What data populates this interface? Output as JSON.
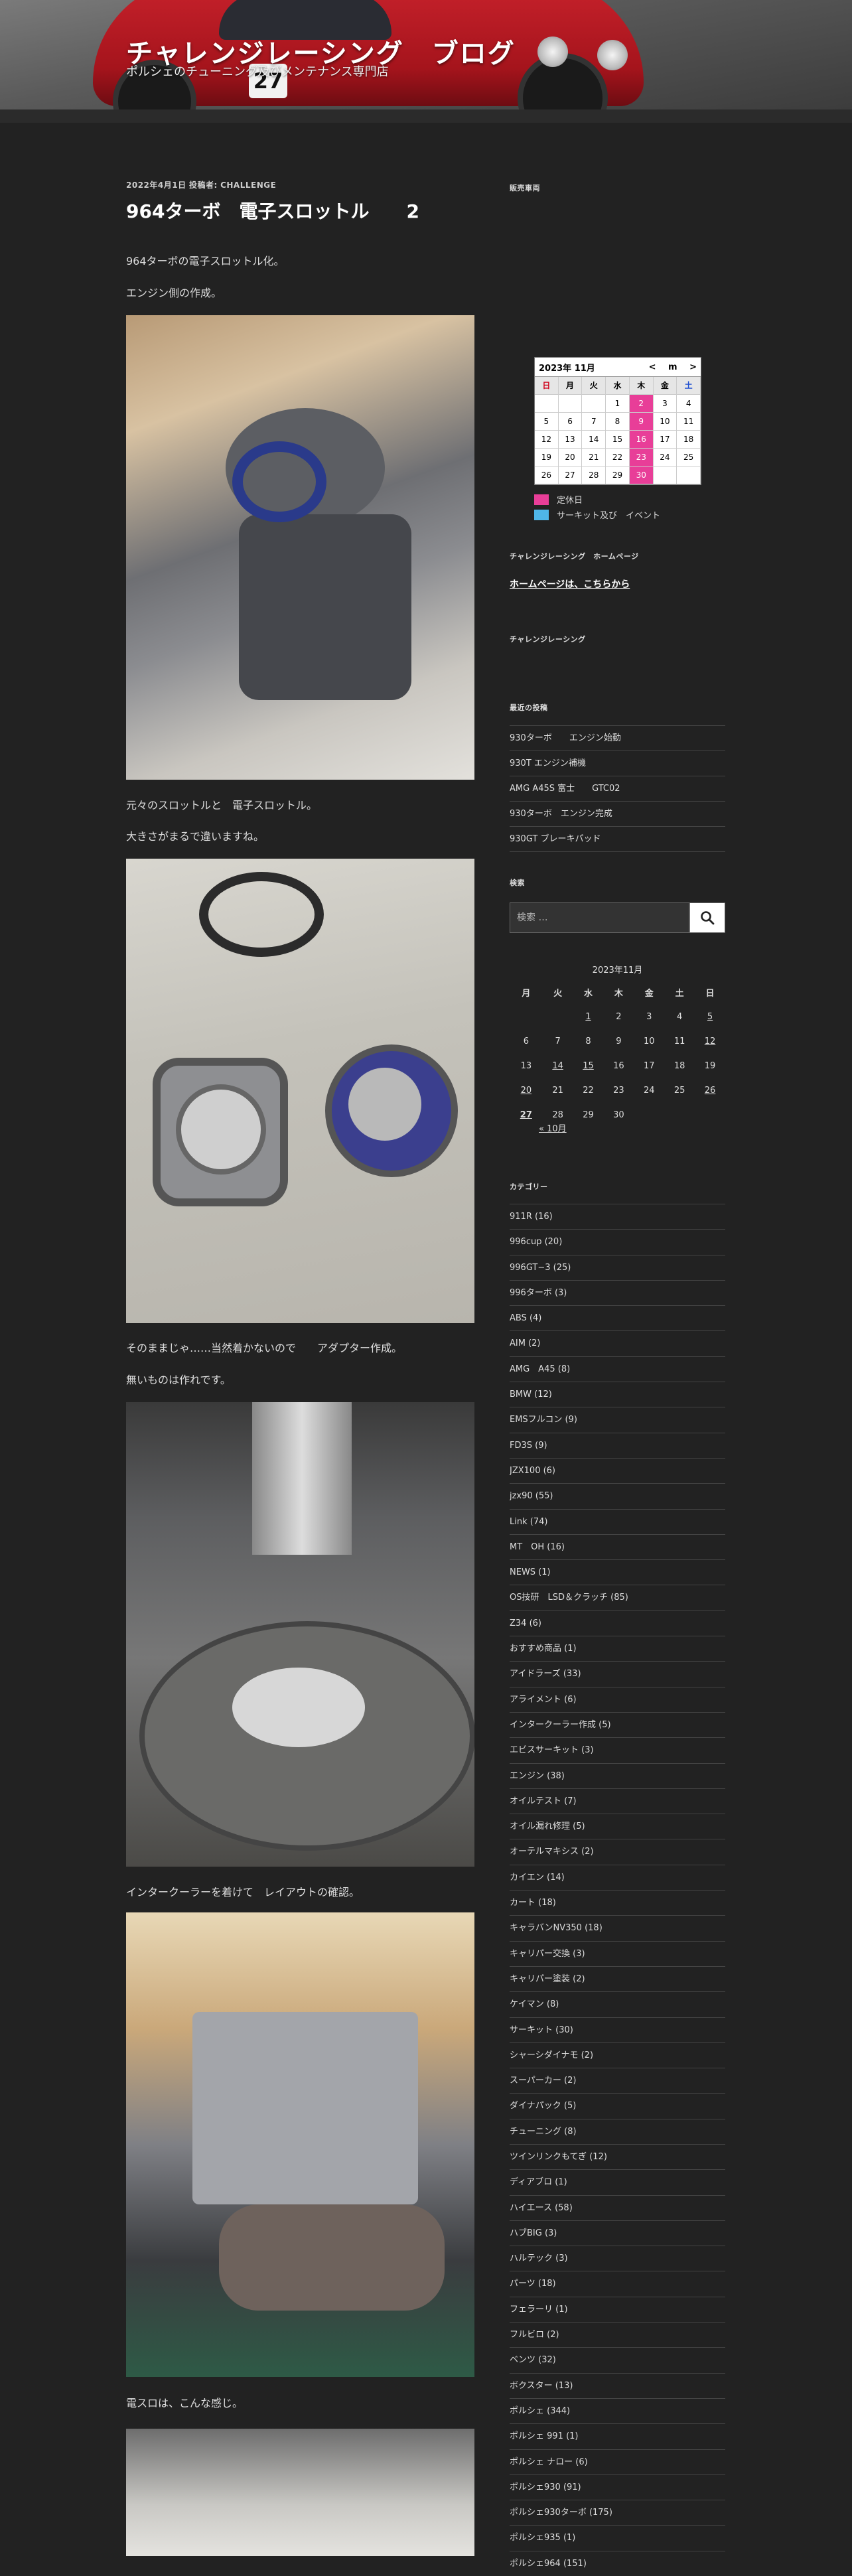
{
  "header": {
    "title": "チャレンジレーシング　ブログ",
    "description": "ポルシェのチューニング及びメンテナンス専門店",
    "car_number": "27"
  },
  "post": {
    "date": "2022年4月1日",
    "author_label": "投稿者:",
    "author": "CHALLENGE",
    "title": "964ターボ　電子スロットル　　2",
    "paragraphs": [
      "964ターボの電子スロットル化。",
      "エンジン側の作成。",
      "元々のスロットルと　電子スロットル。",
      "大きさがまるで違いますね。",
      "そのままじゃ……当然着かないので　　アダプター作成。",
      "無いものは作れです。",
      "インタークーラーを着けて　レイアウトの確認。",
      "電スロは、こんな感じ。"
    ]
  },
  "sidebar": {
    "sales_title": "販売車両",
    "mini_calendar": {
      "month": "2023年 11月",
      "prev": "<",
      "next": ">",
      "mid": "m",
      "dows": [
        "日",
        "月",
        "火",
        "水",
        "木",
        "金",
        "土"
      ],
      "rows": [
        [
          "",
          "",
          "",
          "1",
          "2",
          "3",
          "4"
        ],
        [
          "5",
          "6",
          "7",
          "8",
          "9",
          "10",
          "11"
        ],
        [
          "12",
          "13",
          "14",
          "15",
          "16",
          "17",
          "18"
        ],
        [
          "19",
          "20",
          "21",
          "22",
          "23",
          "24",
          "25"
        ],
        [
          "26",
          "27",
          "28",
          "29",
          "30",
          "",
          ""
        ]
      ],
      "holidays": [
        "2",
        "9",
        "16",
        "23",
        "30"
      ]
    },
    "legend": [
      {
        "label": "定休日",
        "color": "#e83e98"
      },
      {
        "label": "サーキット及び　イベント",
        "color": "#4fb6e8"
      }
    ],
    "homepage_title": "チャレンジレーシング　ホームページ",
    "homepage_link": "ホームページは、こちらから",
    "cr_title": "チャレンジレーシング",
    "recent_title": "最近の投稿",
    "recent_posts": [
      "930ターボ　　エンジン始動",
      "930T エンジン補機",
      "AMG A45S 富士　　GTC02",
      "930ターボ　エンジン完成",
      "930GT ブレーキパッド"
    ],
    "search_title": "検索",
    "search_placeholder": "検索 …",
    "calendar": {
      "caption": "2023年11月",
      "dows": [
        "月",
        "火",
        "水",
        "木",
        "金",
        "土",
        "日"
      ],
      "rows": [
        [
          "",
          "",
          "1",
          "2",
          "3",
          "4",
          "5"
        ],
        [
          "6",
          "7",
          "8",
          "9",
          "10",
          "11",
          "12"
        ],
        [
          "13",
          "14",
          "15",
          "16",
          "17",
          "18",
          "19"
        ],
        [
          "20",
          "21",
          "22",
          "23",
          "24",
          "25",
          "26"
        ],
        [
          "27",
          "28",
          "29",
          "30",
          "",
          "",
          ""
        ]
      ],
      "linked": [
        "1",
        "5",
        "12",
        "14",
        "15",
        "20",
        "26",
        "27"
      ],
      "prev": "« 10月"
    },
    "categories_title": "カテゴリー",
    "categories": [
      "911R (16)",
      "996cup (20)",
      "996GT−3 (25)",
      "996ターボ (3)",
      "ABS (4)",
      "AIM (2)",
      "AMG　A45 (8)",
      "BMW (12)",
      "EMSフルコン (9)",
      "FD3S (9)",
      "JZX100 (6)",
      "jzx90 (55)",
      "Link (74)",
      "MT　OH (16)",
      "NEWS (1)",
      "OS技研　LSD＆クラッチ (85)",
      "Z34 (6)",
      "おすすめ商品 (1)",
      "アイドラーズ (33)",
      "アライメント (6)",
      "インタークーラー作成 (5)",
      "エビスサーキット (3)",
      "エンジン (38)",
      "オイルテスト (7)",
      "オイル漏れ修理 (5)",
      "オーテルマキシス (2)",
      "カイエン (14)",
      "カート (18)",
      "キャラバンNV350 (18)",
      "キャリパー交換 (3)",
      "キャリパー塗装 (2)",
      "ケイマン (8)",
      "サーキット (30)",
      "シャーシダイナモ (2)",
      "スーパーカー (2)",
      "ダイナパック (5)",
      "チューニング (8)",
      "ツインリンクもてぎ (12)",
      "ディアブロ (1)",
      "ハイエース (58)",
      "ハブBIG (3)",
      "ハルテック (3)",
      "パーツ (18)",
      "フェラーリ (1)",
      "フルビロ (2)",
      "ベンツ (32)",
      "ボクスター (13)",
      "ポルシェ (344)",
      "ポルシェ 991 (1)",
      "ポルシェ ナロー (6)",
      "ポルシェ930 (91)",
      "ポルシェ930ターボ (175)",
      "ポルシェ935 (1)",
      "ポルシェ964 (151)"
    ]
  }
}
